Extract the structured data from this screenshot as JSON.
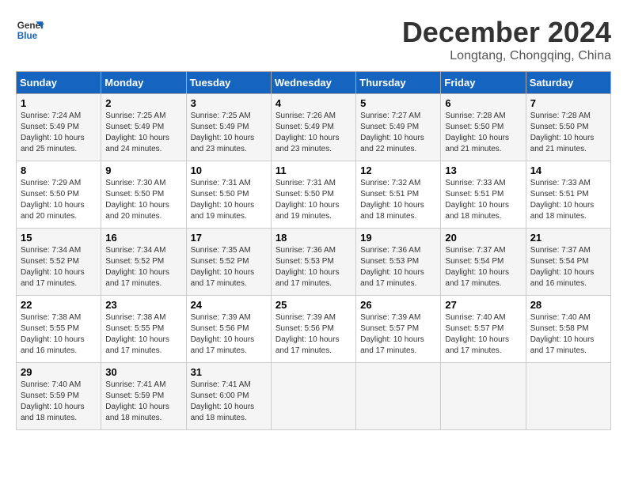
{
  "logo": {
    "line1": "General",
    "line2": "Blue"
  },
  "title": "December 2024",
  "location": "Longtang, Chongqing, China",
  "weekdays": [
    "Sunday",
    "Monday",
    "Tuesday",
    "Wednesday",
    "Thursday",
    "Friday",
    "Saturday"
  ],
  "weeks": [
    [
      {
        "day": "1",
        "sunrise": "7:24 AM",
        "sunset": "5:49 PM",
        "daylight": "10 hours and 25 minutes."
      },
      {
        "day": "2",
        "sunrise": "7:25 AM",
        "sunset": "5:49 PM",
        "daylight": "10 hours and 24 minutes."
      },
      {
        "day": "3",
        "sunrise": "7:25 AM",
        "sunset": "5:49 PM",
        "daylight": "10 hours and 23 minutes."
      },
      {
        "day": "4",
        "sunrise": "7:26 AM",
        "sunset": "5:49 PM",
        "daylight": "10 hours and 23 minutes."
      },
      {
        "day": "5",
        "sunrise": "7:27 AM",
        "sunset": "5:49 PM",
        "daylight": "10 hours and 22 minutes."
      },
      {
        "day": "6",
        "sunrise": "7:28 AM",
        "sunset": "5:50 PM",
        "daylight": "10 hours and 21 minutes."
      },
      {
        "day": "7",
        "sunrise": "7:28 AM",
        "sunset": "5:50 PM",
        "daylight": "10 hours and 21 minutes."
      }
    ],
    [
      {
        "day": "8",
        "sunrise": "7:29 AM",
        "sunset": "5:50 PM",
        "daylight": "10 hours and 20 minutes."
      },
      {
        "day": "9",
        "sunrise": "7:30 AM",
        "sunset": "5:50 PM",
        "daylight": "10 hours and 20 minutes."
      },
      {
        "day": "10",
        "sunrise": "7:31 AM",
        "sunset": "5:50 PM",
        "daylight": "10 hours and 19 minutes."
      },
      {
        "day": "11",
        "sunrise": "7:31 AM",
        "sunset": "5:50 PM",
        "daylight": "10 hours and 19 minutes."
      },
      {
        "day": "12",
        "sunrise": "7:32 AM",
        "sunset": "5:51 PM",
        "daylight": "10 hours and 18 minutes."
      },
      {
        "day": "13",
        "sunrise": "7:33 AM",
        "sunset": "5:51 PM",
        "daylight": "10 hours and 18 minutes."
      },
      {
        "day": "14",
        "sunrise": "7:33 AM",
        "sunset": "5:51 PM",
        "daylight": "10 hours and 18 minutes."
      }
    ],
    [
      {
        "day": "15",
        "sunrise": "7:34 AM",
        "sunset": "5:52 PM",
        "daylight": "10 hours and 17 minutes."
      },
      {
        "day": "16",
        "sunrise": "7:34 AM",
        "sunset": "5:52 PM",
        "daylight": "10 hours and 17 minutes."
      },
      {
        "day": "17",
        "sunrise": "7:35 AM",
        "sunset": "5:52 PM",
        "daylight": "10 hours and 17 minutes."
      },
      {
        "day": "18",
        "sunrise": "7:36 AM",
        "sunset": "5:53 PM",
        "daylight": "10 hours and 17 minutes."
      },
      {
        "day": "19",
        "sunrise": "7:36 AM",
        "sunset": "5:53 PM",
        "daylight": "10 hours and 17 minutes."
      },
      {
        "day": "20",
        "sunrise": "7:37 AM",
        "sunset": "5:54 PM",
        "daylight": "10 hours and 17 minutes."
      },
      {
        "day": "21",
        "sunrise": "7:37 AM",
        "sunset": "5:54 PM",
        "daylight": "10 hours and 16 minutes."
      }
    ],
    [
      {
        "day": "22",
        "sunrise": "7:38 AM",
        "sunset": "5:55 PM",
        "daylight": "10 hours and 16 minutes."
      },
      {
        "day": "23",
        "sunrise": "7:38 AM",
        "sunset": "5:55 PM",
        "daylight": "10 hours and 17 minutes."
      },
      {
        "day": "24",
        "sunrise": "7:39 AM",
        "sunset": "5:56 PM",
        "daylight": "10 hours and 17 minutes."
      },
      {
        "day": "25",
        "sunrise": "7:39 AM",
        "sunset": "5:56 PM",
        "daylight": "10 hours and 17 minutes."
      },
      {
        "day": "26",
        "sunrise": "7:39 AM",
        "sunset": "5:57 PM",
        "daylight": "10 hours and 17 minutes."
      },
      {
        "day": "27",
        "sunrise": "7:40 AM",
        "sunset": "5:57 PM",
        "daylight": "10 hours and 17 minutes."
      },
      {
        "day": "28",
        "sunrise": "7:40 AM",
        "sunset": "5:58 PM",
        "daylight": "10 hours and 17 minutes."
      }
    ],
    [
      {
        "day": "29",
        "sunrise": "7:40 AM",
        "sunset": "5:59 PM",
        "daylight": "10 hours and 18 minutes."
      },
      {
        "day": "30",
        "sunrise": "7:41 AM",
        "sunset": "5:59 PM",
        "daylight": "10 hours and 18 minutes."
      },
      {
        "day": "31",
        "sunrise": "7:41 AM",
        "sunset": "6:00 PM",
        "daylight": "10 hours and 18 minutes."
      },
      null,
      null,
      null,
      null
    ]
  ]
}
